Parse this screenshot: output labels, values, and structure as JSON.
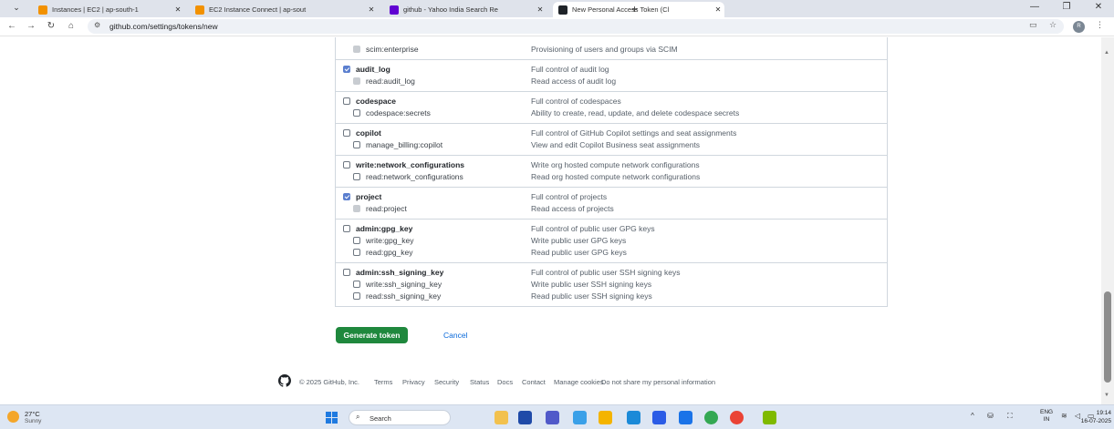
{
  "browser": {
    "tabs": [
      {
        "title": "Instances | EC2 | ap-south-1",
        "icon": "aws-icon",
        "color": "#f29100"
      },
      {
        "title": "EC2 Instance Connect | ap-sout",
        "icon": "aws-icon",
        "color": "#f29100"
      },
      {
        "title": "github - Yahoo India Search Re",
        "icon": "yahoo-icon",
        "color": "#6001d2"
      },
      {
        "title": "New Personal Access Token (Cl",
        "icon": "github-icon",
        "color": "#1f2328",
        "active": true
      }
    ],
    "new_tab": "+",
    "url": "github.com/settings/tokens/new",
    "profile_initial": "R"
  },
  "scopes": {
    "groups": [
      {
        "items": [
          {
            "name": "scim:enterprise",
            "desc": "Provisioning of users and groups via SCIM",
            "state": "disabled",
            "level": "child"
          }
        ]
      },
      {
        "items": [
          {
            "name": "audit_log",
            "desc": "Full control of audit log",
            "state": "checked",
            "level": "parent"
          },
          {
            "name": "read:audit_log",
            "desc": "Read access of audit log",
            "state": "disabled",
            "level": "child"
          }
        ]
      },
      {
        "items": [
          {
            "name": "codespace",
            "desc": "Full control of codespaces",
            "state": "unchecked",
            "level": "parent"
          },
          {
            "name": "codespace:secrets",
            "desc": "Ability to create, read, update, and delete codespace secrets",
            "state": "unchecked",
            "level": "child"
          }
        ]
      },
      {
        "items": [
          {
            "name": "copilot",
            "desc": "Full control of GitHub Copilot settings and seat assignments",
            "state": "unchecked",
            "level": "parent"
          },
          {
            "name": "manage_billing:copilot",
            "desc": "View and edit Copilot Business seat assignments",
            "state": "unchecked",
            "level": "child"
          }
        ]
      },
      {
        "items": [
          {
            "name": "write:network_configurations",
            "desc": "Write org hosted compute network configurations",
            "state": "unchecked",
            "level": "parent"
          },
          {
            "name": "read:network_configurations",
            "desc": "Read org hosted compute network configurations",
            "state": "unchecked",
            "level": "child"
          }
        ]
      },
      {
        "items": [
          {
            "name": "project",
            "desc": "Full control of projects",
            "state": "checked",
            "level": "parent"
          },
          {
            "name": "read:project",
            "desc": "Read access of projects",
            "state": "disabled",
            "level": "child"
          }
        ]
      },
      {
        "items": [
          {
            "name": "admin:gpg_key",
            "desc": "Full control of public user GPG keys",
            "state": "unchecked",
            "level": "parent"
          },
          {
            "name": "write:gpg_key",
            "desc": "Write public user GPG keys",
            "state": "unchecked",
            "level": "child"
          },
          {
            "name": "read:gpg_key",
            "desc": "Read public user GPG keys",
            "state": "unchecked",
            "level": "child"
          }
        ]
      },
      {
        "items": [
          {
            "name": "admin:ssh_signing_key",
            "desc": "Full control of public user SSH signing keys",
            "state": "unchecked",
            "level": "parent"
          },
          {
            "name": "write:ssh_signing_key",
            "desc": "Write public user SSH signing keys",
            "state": "unchecked",
            "level": "child"
          },
          {
            "name": "read:ssh_signing_key",
            "desc": "Read public user SSH signing keys",
            "state": "unchecked",
            "level": "child"
          }
        ]
      }
    ]
  },
  "actions": {
    "generate": "Generate token",
    "cancel": "Cancel"
  },
  "footer": {
    "copyright": "© 2025 GitHub, Inc.",
    "links": [
      "Terms",
      "Privacy",
      "Security",
      "Status",
      "Docs",
      "Contact",
      "Manage cookies",
      "Do not share my personal information"
    ]
  },
  "taskbar": {
    "temperature": "27°C",
    "condition": "Sunny",
    "search_placeholder": "Search",
    "apps": [
      {
        "name": "windows-explorer-icon",
        "color": "#f2c14e"
      },
      {
        "name": "media-player-icon",
        "color": "#1f4aa8"
      },
      {
        "name": "teams-icon",
        "color": "#5059c9"
      },
      {
        "name": "copilot-icon",
        "color": "#3aa0e8"
      },
      {
        "name": "file-explorer-icon",
        "color": "#f4b400"
      },
      {
        "name": "edge-icon",
        "color": "#1b8ad8"
      },
      {
        "name": "store-icon",
        "color": "#2b5ce6"
      },
      {
        "name": "mail-icon",
        "color": "#1a73e8"
      },
      {
        "name": "chrome-icon",
        "color": "#34a853"
      },
      {
        "name": "chrome-profile-icon",
        "color": "#ea4335"
      },
      {
        "name": "photos-icon",
        "color": "#7fba00"
      }
    ],
    "lang_top": "ENG",
    "lang_bottom": "IN",
    "time": "19:14",
    "date": "16-07-2025"
  }
}
